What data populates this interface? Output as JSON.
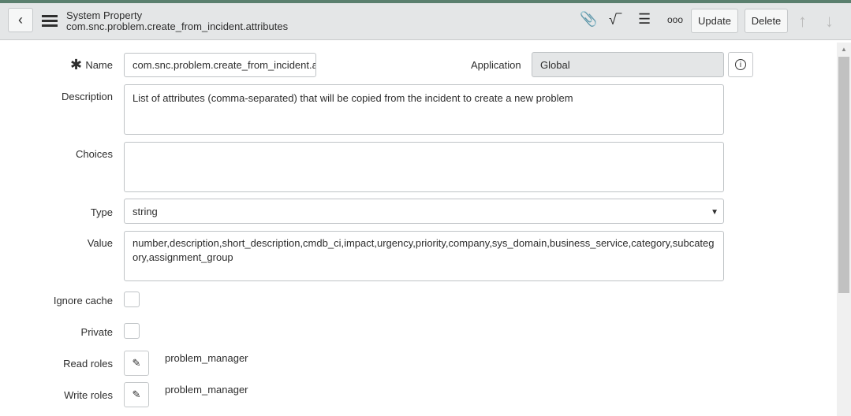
{
  "header": {
    "title": "System Property",
    "subtitle": "com.snc.problem.create_from_incident.attributes",
    "update_label": "Update",
    "delete_label": "Delete"
  },
  "icons": [
    "back-icon",
    "menu-icon",
    "paperclip-icon",
    "activity-icon",
    "sliders-icon",
    "more-icon",
    "arrow-up-icon",
    "arrow-down-icon",
    "info-icon",
    "pencil-icon"
  ],
  "form": {
    "name_label": "Name",
    "name_value": "com.snc.problem.create_from_incident.a",
    "application_label": "Application",
    "application_value": "Global",
    "description_label": "Description",
    "description_value": "List of attributes (comma-separated) that will be copied from the incident to create a new problem",
    "choices_label": "Choices",
    "choices_value": "",
    "type_label": "Type",
    "type_value": "string",
    "value_label": "Value",
    "value_value": "number,description,short_description,cmdb_ci,impact,urgency,priority,company,sys_domain,business_service,category,subcategory,assignment_group",
    "ignore_cache_label": "Ignore cache",
    "private_label": "Private",
    "read_roles_label": "Read roles",
    "read_roles_value": "problem_manager",
    "write_roles_label": "Write roles",
    "write_roles_value": "problem_manager"
  }
}
